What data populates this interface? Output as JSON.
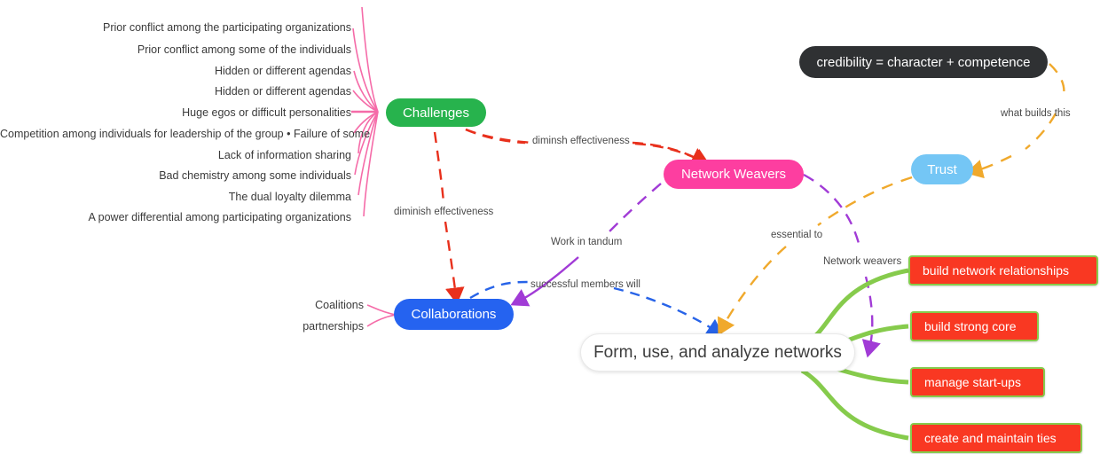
{
  "diagram": {
    "type": "mind-map",
    "title": "Form, use, and analyze networks",
    "background_color": "#ffffff",
    "colors": {
      "challenges_green": "#27b34d",
      "weavers_pink": "#fd3ea0",
      "trust_blue": "#74c6f5",
      "collaborations_blue": "#2563f0",
      "credibility_dark": "#2f3133",
      "action_box_red": "#f93822",
      "action_box_border_green": "#86cb4c",
      "branch_pink": "#f56ba8",
      "edge_red": "#e8301c",
      "edge_purple": "#a13bd6",
      "edge_orange": "#f0a92c",
      "edge_blue": "#2763e8",
      "edge_green": "#86cb4c"
    }
  },
  "nodes": {
    "central": {
      "label": "Form, use, and analyze networks"
    },
    "challenges": {
      "label": "Challenges"
    },
    "network_weavers": {
      "label": "Network Weavers"
    },
    "trust": {
      "label": "Trust"
    },
    "collaborations": {
      "label": "Collaborations"
    },
    "credibility": {
      "label": "credibility = character + competence"
    }
  },
  "challenges_list": [
    {
      "label": "Prior conflict among the participating organizations"
    },
    {
      "label": "Prior conflict among some of the individuals"
    },
    {
      "label": "Hidden or different agendas"
    },
    {
      "label": "Hidden or different agendas"
    },
    {
      "label": "Huge egos or difficult personalities"
    },
    {
      "label": "Competition among individuals for leadership of the group • Failure of some"
    },
    {
      "label": "Lack of information sharing"
    },
    {
      "label": "Bad chemistry among some individuals"
    },
    {
      "label": "The dual loyalty dilemma"
    },
    {
      "label": "A power differential among participating organizations"
    }
  ],
  "collaboration_children": [
    {
      "label": "Coalitions"
    },
    {
      "label": "partnerships"
    }
  ],
  "action_boxes": [
    {
      "label": "build network relationships"
    },
    {
      "label": "build strong core"
    },
    {
      "label": "manage start-ups"
    },
    {
      "label": "create and maintain ties"
    }
  ],
  "edge_labels": {
    "diminsh_effectiveness_upper": "diminsh effectiveness",
    "diminish_effectiveness_lower": "diminish effectiveness",
    "work_in_tandum": "Work in tandum",
    "successful_members_will": "successful members will",
    "essential_to": "essential to",
    "network_weavers_lower": "Network weavers",
    "what_builds_this": "what builds this"
  }
}
